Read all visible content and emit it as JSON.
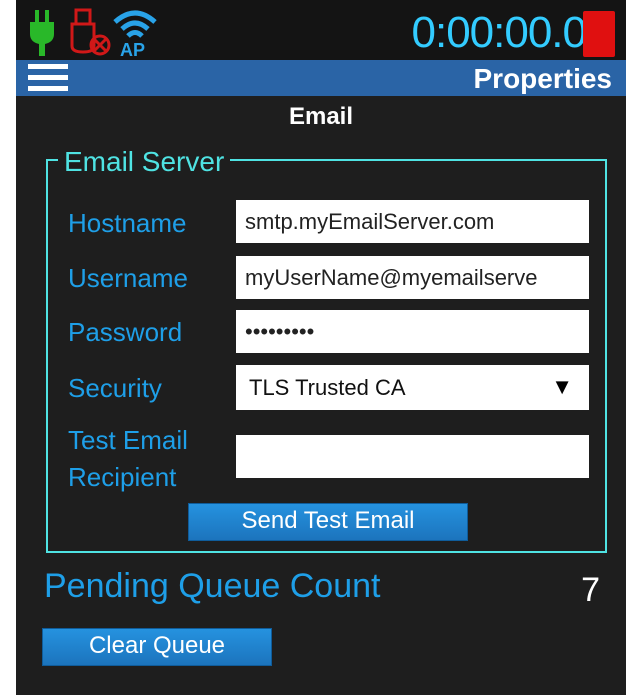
{
  "status": {
    "timer": "0:00:00.0",
    "icons": [
      "power-plug-icon",
      "usb-disconnected-icon",
      "wifi-ap-icon"
    ],
    "ap_label": "AP"
  },
  "header": {
    "title": "Properties",
    "menu_icon": "hamburger-menu-icon"
  },
  "section_title": "Email",
  "email_server": {
    "legend": "Email Server",
    "hostname": {
      "label": "Hostname",
      "value": "smtp.myEmailServer.com"
    },
    "username": {
      "label": "Username",
      "value": "myUserName@myemailserve"
    },
    "password": {
      "label": "Password",
      "value": "•••••••••"
    },
    "security": {
      "label": "Security",
      "value": "TLS Trusted CA"
    },
    "test_recipient": {
      "label_line1": "Test Email",
      "label_line2": "Recipient",
      "value": ""
    },
    "send_button": "Send Test Email"
  },
  "queue": {
    "label": "Pending Queue Count",
    "count": "7",
    "clear_button": "Clear Queue"
  },
  "colors": {
    "accent": "#1e9fe8",
    "border": "#4fe3e3",
    "title_bar": "#2a64a6",
    "record": "#e01010"
  }
}
